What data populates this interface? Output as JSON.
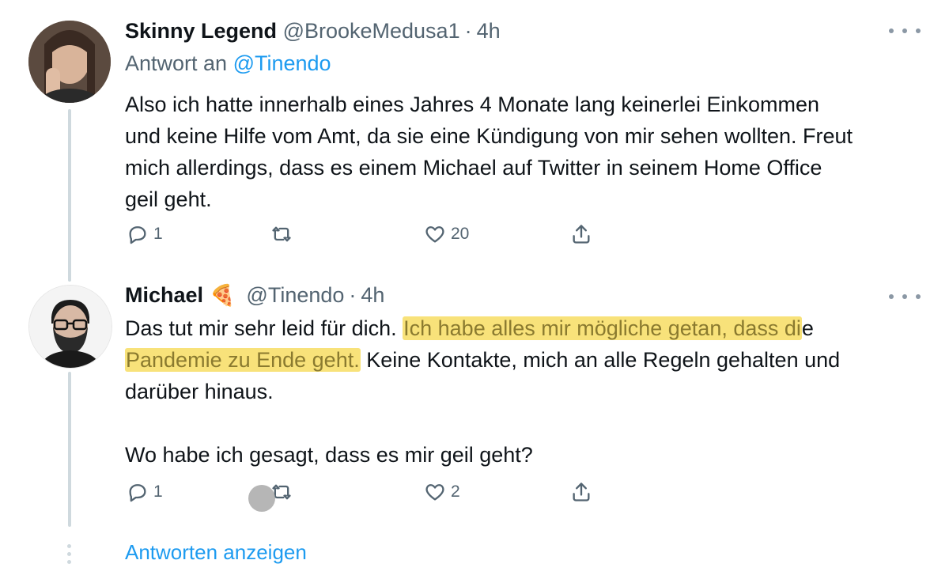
{
  "tweets": [
    {
      "display_name": "Skinny Legend",
      "handle": "@BrookeMedusa1",
      "separator": "·",
      "time": "4h",
      "reply_prefix": "Antwort an",
      "reply_mention": "@Tinendo",
      "text_lines": [
        "Also ich hatte innerhalb eines Jahres 4 Monate lang keinerlei Einkommen",
        "und keine Hilfe vom Amt, da sie eine Kündigung von mir sehen wollten. Freut",
        "mich allerdings, dass es einem Michael auf Twitter in seinem Home Office",
        "geil geht."
      ],
      "replies": "1",
      "retweets": "",
      "likes": "20"
    },
    {
      "display_name": "Michael",
      "name_emoji": "🍕",
      "handle": "@Tinendo",
      "separator": "·",
      "time": "4h",
      "text_parts": {
        "line1_plain": "Das tut mir sehr leid für dich. ",
        "line1_highlight": "Ich habe alles mir mögliche getan, dass di",
        "line1_tail": "e",
        "line2_highlight": "Pandemie zu Ende geht.",
        "line2_plain": " Keine Kontakte, mich an alle Regeln gehalten und",
        "line3": "darüber hinaus.",
        "line4": "Wo habe ich gesagt, dass es mir geil geht?"
      },
      "replies": "1",
      "retweets": "",
      "likes": "2"
    }
  ],
  "show_replies_label": "Antworten anzeigen",
  "colors": {
    "accent": "#1d9bf0",
    "highlight": "#f8e27a",
    "secondary_text": "#536471",
    "thread_line": "#cfd9de"
  },
  "icons": [
    "reply-icon",
    "retweet-icon",
    "like-icon",
    "share-icon",
    "more-icon"
  ]
}
